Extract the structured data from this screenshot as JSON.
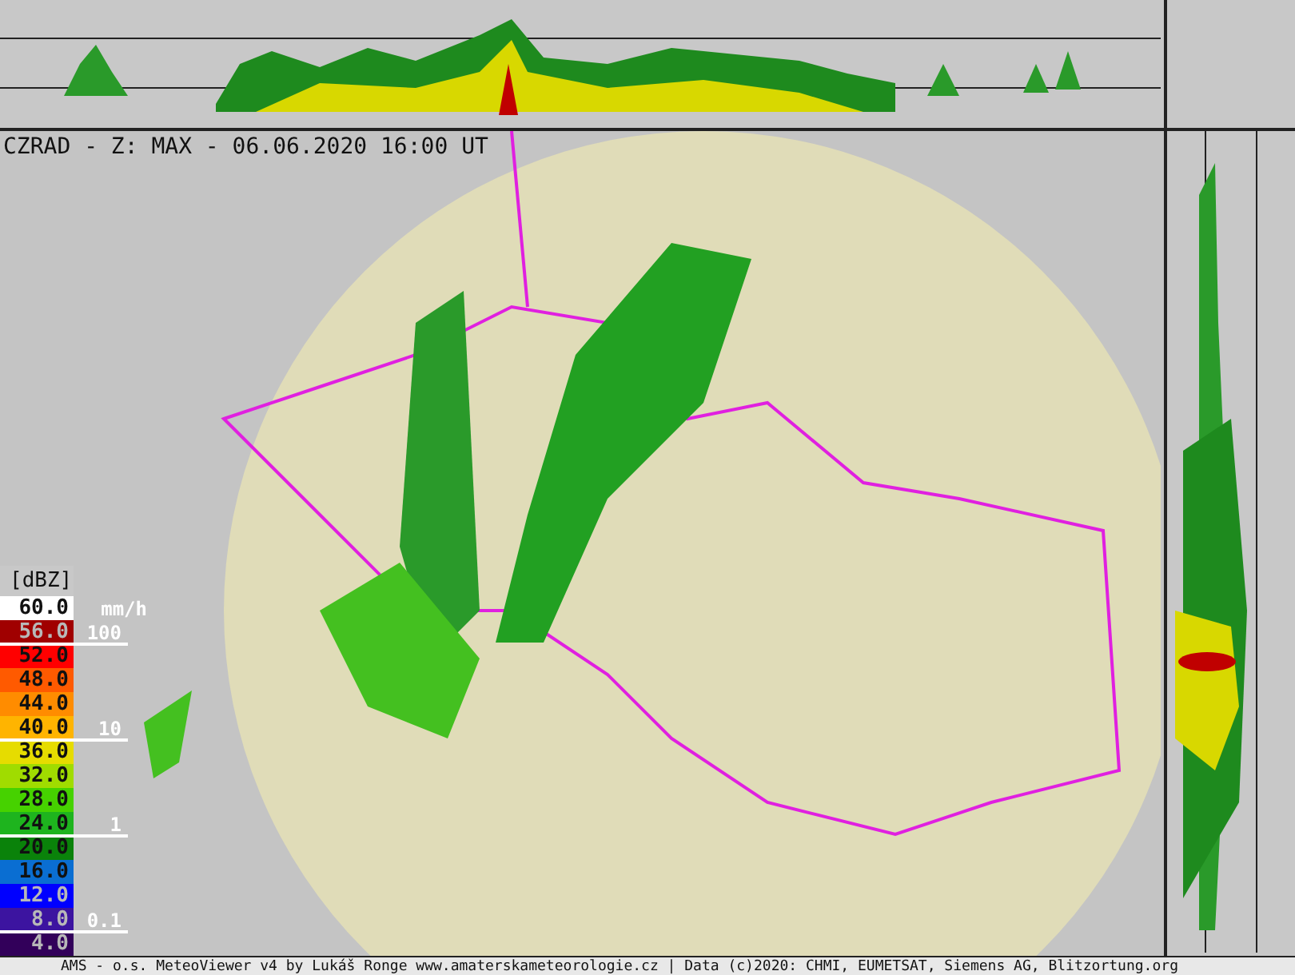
{
  "title": "CZRAD - Z: MAX - 06.06.2020 16:00 UT",
  "legend": {
    "unit": "[dBZ]",
    "rate_unit": "mm/h",
    "steps": [
      {
        "label": "60.0",
        "color": "#ffffff"
      },
      {
        "label": "56.0",
        "color": "#a00000"
      },
      {
        "label": "52.0",
        "color": "#ff0000"
      },
      {
        "label": "48.0",
        "color": "#ff5a00"
      },
      {
        "label": "44.0",
        "color": "#ff8c00"
      },
      {
        "label": "40.0",
        "color": "#ffb400"
      },
      {
        "label": "36.0",
        "color": "#e6dc00"
      },
      {
        "label": "32.0",
        "color": "#a0dc00"
      },
      {
        "label": "28.0",
        "color": "#46d200"
      },
      {
        "label": "24.0",
        "color": "#1eb41e"
      },
      {
        "label": "20.0",
        "color": "#0a820a"
      },
      {
        "label": "16.0",
        "color": "#0a6ed2"
      },
      {
        "label": "12.0",
        "color": "#0000ff"
      },
      {
        "label": "8.0",
        "color": "#3c14a0"
      },
      {
        "label": "4.0",
        "color": "#32005a"
      }
    ],
    "rates": [
      "100",
      "10",
      "1",
      "0.1"
    ]
  },
  "footer": "AMS - o.s. MeteoViewer v4 by Lukáš Ronge www.amaterskameteorologie.cz | Data (c)2020: CHMI, EUMETSAT, Siemens AG, Blitzortung.org"
}
